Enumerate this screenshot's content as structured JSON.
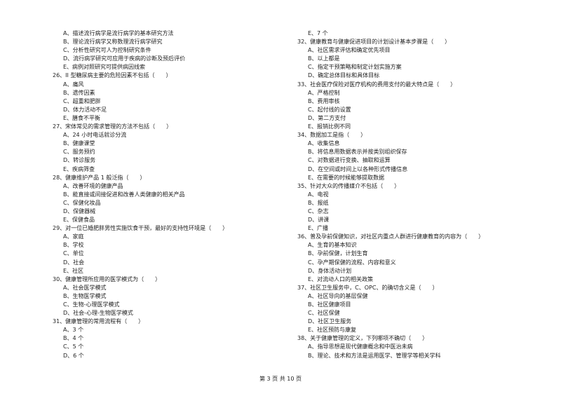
{
  "columns": [
    [
      {
        "type": "option",
        "text": "A、描述流行病学是流行病学的基本研究方法"
      },
      {
        "type": "option",
        "text": "B、理论流行病学又称数理流行病学研究"
      },
      {
        "type": "option",
        "text": "C、分析性研究可人为控制研究条件"
      },
      {
        "type": "option",
        "text": "D、流行病学研究可应用于疾病的诊断及预后评价"
      },
      {
        "type": "option",
        "text": "E、病例对照研究可提供病因线索"
      },
      {
        "type": "question",
        "text": "26、II 型糖尿病主要的危险因素不包括（　　）"
      },
      {
        "type": "option",
        "text": "A、痛风"
      },
      {
        "type": "option",
        "text": "B、遗传因素"
      },
      {
        "type": "option",
        "text": "C、超重和肥胖"
      },
      {
        "type": "option",
        "text": "D、体力活动不足"
      },
      {
        "type": "option",
        "text": "E、膳食不平衡"
      },
      {
        "type": "question",
        "text": "27、宋体常见的需求管理的方法不包括（　　）"
      },
      {
        "type": "option",
        "text": "A、24 小时电话就诊分流"
      },
      {
        "type": "option",
        "text": "B、健康课堂"
      },
      {
        "type": "option",
        "text": "C、服务预约"
      },
      {
        "type": "option",
        "text": "D、转诊服务"
      },
      {
        "type": "option",
        "text": "E、疾病筛查"
      },
      {
        "type": "question",
        "text": "28、健康维护产品 1 般泛指（　　）"
      },
      {
        "type": "option",
        "text": "A、改善环境的健康产品"
      },
      {
        "type": "option",
        "text": "B、能直接或间接促进和改善人类健康的相关产品"
      },
      {
        "type": "option",
        "text": "C、保健化妆品"
      },
      {
        "type": "option",
        "text": "D、保健器械"
      },
      {
        "type": "option",
        "text": "E、保健食品"
      },
      {
        "type": "question",
        "text": "29、对一位已婚肥胖男性实施饮食干预，最好的支持性环境是（　　）"
      },
      {
        "type": "option",
        "text": "A、家庭"
      },
      {
        "type": "option",
        "text": "B、学校"
      },
      {
        "type": "option",
        "text": "C、单位"
      },
      {
        "type": "option",
        "text": "D、社会"
      },
      {
        "type": "option",
        "text": "E、社区"
      },
      {
        "type": "question",
        "text": "30、健康管理所应用的医学模式为（　　）"
      },
      {
        "type": "option",
        "text": "A、社会医学模式"
      },
      {
        "type": "option",
        "text": "B、生物医学模式"
      },
      {
        "type": "option",
        "text": "C、生物-心理医学模式"
      },
      {
        "type": "option",
        "text": "D、社会-心理-生物医学模式"
      },
      {
        "type": "question",
        "text": "31、健康管理的常用流程有（　　）"
      },
      {
        "type": "option",
        "text": "A、3 个"
      },
      {
        "type": "option",
        "text": "B、4 个"
      },
      {
        "type": "option",
        "text": "C、5 个"
      },
      {
        "type": "option",
        "text": "D、6 个"
      }
    ],
    [
      {
        "type": "option",
        "text": "E、7 个"
      },
      {
        "type": "question",
        "text": "32、健康教育与健康促进项目的计划设计基本步骤是（　　）"
      },
      {
        "type": "option",
        "text": "A、社区需求评估和确定优先项目"
      },
      {
        "type": "option",
        "text": "B、以上都是"
      },
      {
        "type": "option",
        "text": "C、指定干预策略和制定计划实施方案"
      },
      {
        "type": "option",
        "text": "D、确定总体目标和具体目标"
      },
      {
        "type": "question",
        "text": "33、社会医疗保险对医疗机构的费用支付的最大特点是（　　）"
      },
      {
        "type": "option",
        "text": "A、严格控制"
      },
      {
        "type": "option",
        "text": "B、费用审核"
      },
      {
        "type": "option",
        "text": "C、起付线的设置"
      },
      {
        "type": "option",
        "text": "D、第二方支付"
      },
      {
        "type": "option",
        "text": "E、报销比例不同"
      },
      {
        "type": "question",
        "text": "34、数据加工是指（　　）"
      },
      {
        "type": "option",
        "text": "A、收集信息"
      },
      {
        "type": "option",
        "text": "B、将信息用数据表示并按类别组织保存"
      },
      {
        "type": "option",
        "text": "C、对数据进行变换、抽取和运算"
      },
      {
        "type": "option",
        "text": "D、在空间或时间上以各种形式传播信息"
      },
      {
        "type": "option",
        "text": "E、在需要的时候能够提取数据"
      },
      {
        "type": "question",
        "text": "35、针对大众的传播媒介不包括（　　）"
      },
      {
        "type": "option",
        "text": "A、电视"
      },
      {
        "type": "option",
        "text": "B、报纸"
      },
      {
        "type": "option",
        "text": "C、杂志"
      },
      {
        "type": "option",
        "text": "D、讲课"
      },
      {
        "type": "option",
        "text": "E、广播"
      },
      {
        "type": "question",
        "text": "36、普及孕前保健知识，对社区内重点人群进行健康教育的内容为（　　）"
      },
      {
        "type": "option",
        "text": "A、生育的基本知识"
      },
      {
        "type": "option",
        "text": "B、孕前保健，计划生育"
      },
      {
        "type": "option",
        "text": "C、孕产期保健的流程、内容和意义"
      },
      {
        "type": "option",
        "text": "D、身体活动计划"
      },
      {
        "type": "option",
        "text": "E、对流动人口的相关政策"
      },
      {
        "type": "question",
        "text": "37、社区卫生服务中，C、OPC、的确切含义是（　　）"
      },
      {
        "type": "option",
        "text": "A、社区导向的基层保健"
      },
      {
        "type": "option",
        "text": "B、社区健康项目"
      },
      {
        "type": "option",
        "text": "C、社区保健"
      },
      {
        "type": "option",
        "text": "D、社区卫生服务"
      },
      {
        "type": "option",
        "text": "E、社区预防与康复"
      },
      {
        "type": "question",
        "text": "38、关于健康管理的定义，下列哪项不确切（　　）"
      },
      {
        "type": "option",
        "text": "A、指导思想是现代健康概念和中医治未病"
      },
      {
        "type": "option",
        "text": "B、理论、技术和方法是运用医学、管理学等相关学科"
      }
    ]
  ],
  "footer": {
    "page_label": "第 3 页 共 10 页"
  }
}
